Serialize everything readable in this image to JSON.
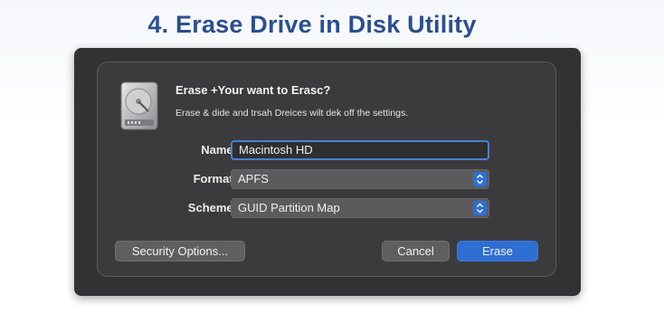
{
  "page": {
    "heading": "4. Erase Drive in Disk Utility"
  },
  "dialog": {
    "title": "Erase +Your want to Erasc?",
    "message": "Erase & dide and trsah Dreices wilt dek off the settings.",
    "icon": "hard-drive-icon",
    "fields": {
      "name_label": "Name:",
      "name_value": "Macintosh HD",
      "format_label": "Format:",
      "format_value": "APFS",
      "scheme_label": "Scheme:",
      "scheme_value": "GUID Partition Map"
    },
    "buttons": {
      "security_options": "Security Options...",
      "cancel": "Cancel",
      "erase": "Erase"
    }
  },
  "colors": {
    "heading": "#2a4f8f",
    "accent": "#2f6ed2",
    "dialog_background": "#3b3b3d"
  }
}
